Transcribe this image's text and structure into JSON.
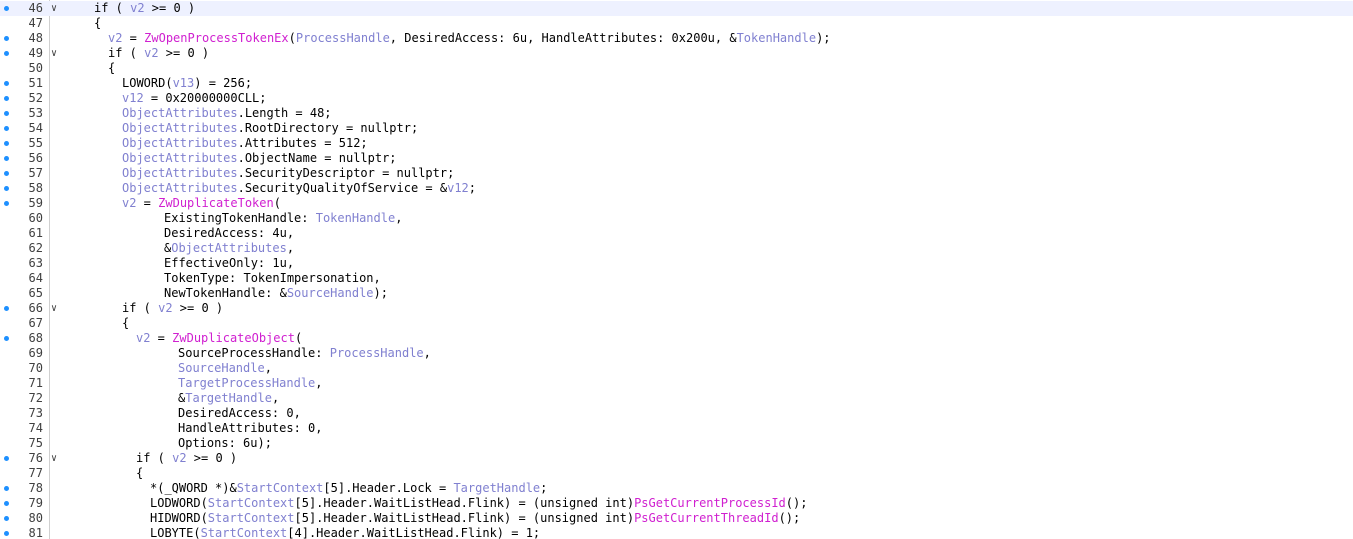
{
  "colors": {
    "variable": "#8080d0",
    "function": "#d020d0",
    "text": "#000000",
    "breakpoint_dot": "#1e90ff"
  },
  "lines": [
    {
      "num": "46",
      "dot": true,
      "fold": true,
      "hl": true,
      "indent": 2,
      "segs": [
        [
          "t",
          "if ( "
        ],
        [
          "v",
          "v2"
        ],
        [
          "t",
          " >= 0 )"
        ]
      ]
    },
    {
      "num": "47",
      "dot": false,
      "fold": false,
      "indent": 2,
      "segs": [
        [
          "t",
          "{"
        ]
      ]
    },
    {
      "num": "48",
      "dot": true,
      "fold": false,
      "indent": 3,
      "segs": [
        [
          "v",
          "v2"
        ],
        [
          "t",
          " = "
        ],
        [
          "f",
          "ZwOpenProcessTokenEx"
        ],
        [
          "t",
          "("
        ],
        [
          "v",
          "ProcessHandle"
        ],
        [
          "t",
          ", DesiredAccess: 6u, HandleAttributes: 0x200u, &"
        ],
        [
          "v",
          "TokenHandle"
        ],
        [
          "t",
          ");"
        ]
      ]
    },
    {
      "num": "49",
      "dot": true,
      "fold": true,
      "indent": 3,
      "segs": [
        [
          "t",
          "if ( "
        ],
        [
          "v",
          "v2"
        ],
        [
          "t",
          " >= 0 )"
        ]
      ]
    },
    {
      "num": "50",
      "dot": false,
      "fold": false,
      "indent": 3,
      "segs": [
        [
          "t",
          "{"
        ]
      ]
    },
    {
      "num": "51",
      "dot": true,
      "fold": false,
      "indent": 4,
      "segs": [
        [
          "t",
          "LOWORD("
        ],
        [
          "v",
          "v13"
        ],
        [
          "t",
          ") = 256;"
        ]
      ]
    },
    {
      "num": "52",
      "dot": true,
      "fold": false,
      "indent": 4,
      "segs": [
        [
          "v",
          "v12"
        ],
        [
          "t",
          " = 0x20000000CLL;"
        ]
      ]
    },
    {
      "num": "53",
      "dot": true,
      "fold": false,
      "indent": 4,
      "segs": [
        [
          "v",
          "ObjectAttributes"
        ],
        [
          "t",
          ".Length = 48;"
        ]
      ]
    },
    {
      "num": "54",
      "dot": true,
      "fold": false,
      "indent": 4,
      "segs": [
        [
          "v",
          "ObjectAttributes"
        ],
        [
          "t",
          ".RootDirectory = nullptr;"
        ]
      ]
    },
    {
      "num": "55",
      "dot": true,
      "fold": false,
      "indent": 4,
      "segs": [
        [
          "v",
          "ObjectAttributes"
        ],
        [
          "t",
          ".Attributes = 512;"
        ]
      ]
    },
    {
      "num": "56",
      "dot": true,
      "fold": false,
      "indent": 4,
      "segs": [
        [
          "v",
          "ObjectAttributes"
        ],
        [
          "t",
          ".ObjectName = nullptr;"
        ]
      ]
    },
    {
      "num": "57",
      "dot": true,
      "fold": false,
      "indent": 4,
      "segs": [
        [
          "v",
          "ObjectAttributes"
        ],
        [
          "t",
          ".SecurityDescriptor = nullptr;"
        ]
      ]
    },
    {
      "num": "58",
      "dot": true,
      "fold": false,
      "indent": 4,
      "segs": [
        [
          "v",
          "ObjectAttributes"
        ],
        [
          "t",
          ".SecurityQualityOfService = &"
        ],
        [
          "v",
          "v12"
        ],
        [
          "t",
          ";"
        ]
      ]
    },
    {
      "num": "59",
      "dot": true,
      "fold": false,
      "indent": 4,
      "segs": [
        [
          "v",
          "v2"
        ],
        [
          "t",
          " = "
        ],
        [
          "f",
          "ZwDuplicateToken"
        ],
        [
          "t",
          "("
        ]
      ]
    },
    {
      "num": "60",
      "dot": false,
      "fold": false,
      "indent": 7,
      "segs": [
        [
          "t",
          "ExistingTokenHandle: "
        ],
        [
          "v",
          "TokenHandle"
        ],
        [
          "t",
          ","
        ]
      ]
    },
    {
      "num": "61",
      "dot": false,
      "fold": false,
      "indent": 7,
      "segs": [
        [
          "t",
          "DesiredAccess: 4u,"
        ]
      ]
    },
    {
      "num": "62",
      "dot": false,
      "fold": false,
      "indent": 7,
      "segs": [
        [
          "t",
          "&"
        ],
        [
          "v",
          "ObjectAttributes"
        ],
        [
          "t",
          ","
        ]
      ]
    },
    {
      "num": "63",
      "dot": false,
      "fold": false,
      "indent": 7,
      "segs": [
        [
          "t",
          "EffectiveOnly: 1u,"
        ]
      ]
    },
    {
      "num": "64",
      "dot": false,
      "fold": false,
      "indent": 7,
      "segs": [
        [
          "t",
          "TokenType: TokenImpersonation,"
        ]
      ]
    },
    {
      "num": "65",
      "dot": false,
      "fold": false,
      "indent": 7,
      "segs": [
        [
          "t",
          "NewTokenHandle: &"
        ],
        [
          "v",
          "SourceHandle"
        ],
        [
          "t",
          ");"
        ]
      ]
    },
    {
      "num": "66",
      "dot": true,
      "fold": true,
      "indent": 4,
      "segs": [
        [
          "t",
          "if ( "
        ],
        [
          "v",
          "v2"
        ],
        [
          "t",
          " >= 0 )"
        ]
      ]
    },
    {
      "num": "67",
      "dot": false,
      "fold": false,
      "indent": 4,
      "segs": [
        [
          "t",
          "{"
        ]
      ]
    },
    {
      "num": "68",
      "dot": true,
      "fold": false,
      "indent": 5,
      "segs": [
        [
          "v",
          "v2"
        ],
        [
          "t",
          " = "
        ],
        [
          "f",
          "ZwDuplicateObject"
        ],
        [
          "t",
          "("
        ]
      ]
    },
    {
      "num": "69",
      "dot": false,
      "fold": false,
      "indent": 8,
      "segs": [
        [
          "t",
          "SourceProcessHandle: "
        ],
        [
          "v",
          "ProcessHandle"
        ],
        [
          "t",
          ","
        ]
      ]
    },
    {
      "num": "70",
      "dot": false,
      "fold": false,
      "indent": 8,
      "segs": [
        [
          "v",
          "SourceHandle"
        ],
        [
          "t",
          ","
        ]
      ]
    },
    {
      "num": "71",
      "dot": false,
      "fold": false,
      "indent": 8,
      "segs": [
        [
          "v",
          "TargetProcessHandle"
        ],
        [
          "t",
          ","
        ]
      ]
    },
    {
      "num": "72",
      "dot": false,
      "fold": false,
      "indent": 8,
      "segs": [
        [
          "t",
          "&"
        ],
        [
          "v",
          "TargetHandle"
        ],
        [
          "t",
          ","
        ]
      ]
    },
    {
      "num": "73",
      "dot": false,
      "fold": false,
      "indent": 8,
      "segs": [
        [
          "t",
          "DesiredAccess: 0,"
        ]
      ]
    },
    {
      "num": "74",
      "dot": false,
      "fold": false,
      "indent": 8,
      "segs": [
        [
          "t",
          "HandleAttributes: 0,"
        ]
      ]
    },
    {
      "num": "75",
      "dot": false,
      "fold": false,
      "indent": 8,
      "segs": [
        [
          "t",
          "Options: 6u);"
        ]
      ]
    },
    {
      "num": "76",
      "dot": true,
      "fold": true,
      "indent": 5,
      "segs": [
        [
          "t",
          "if ( "
        ],
        [
          "v",
          "v2"
        ],
        [
          "t",
          " >= 0 )"
        ]
      ]
    },
    {
      "num": "77",
      "dot": false,
      "fold": false,
      "indent": 5,
      "segs": [
        [
          "t",
          "{"
        ]
      ]
    },
    {
      "num": "78",
      "dot": true,
      "fold": false,
      "indent": 6,
      "segs": [
        [
          "t",
          "*(_QWORD *)&"
        ],
        [
          "v",
          "StartContext"
        ],
        [
          "t",
          "[5].Header.Lock = "
        ],
        [
          "v",
          "TargetHandle"
        ],
        [
          "t",
          ";"
        ]
      ]
    },
    {
      "num": "79",
      "dot": true,
      "fold": false,
      "indent": 6,
      "segs": [
        [
          "t",
          "LODWORD("
        ],
        [
          "v",
          "StartContext"
        ],
        [
          "t",
          "[5].Header.WaitListHead.Flink) = (unsigned int)"
        ],
        [
          "f",
          "PsGetCurrentProcessId"
        ],
        [
          "t",
          "();"
        ]
      ]
    },
    {
      "num": "80",
      "dot": true,
      "fold": false,
      "indent": 6,
      "segs": [
        [
          "t",
          "HIDWORD("
        ],
        [
          "v",
          "StartContext"
        ],
        [
          "t",
          "[5].Header.WaitListHead.Flink) = (unsigned int)"
        ],
        [
          "f",
          "PsGetCurrentThreadId"
        ],
        [
          "t",
          "();"
        ]
      ]
    },
    {
      "num": "81",
      "dot": true,
      "fold": false,
      "indent": 6,
      "segs": [
        [
          "t",
          "LOBYTE("
        ],
        [
          "v",
          "StartContext"
        ],
        [
          "t",
          "[4].Header.WaitListHead.Flink) = 1;"
        ]
      ]
    }
  ]
}
